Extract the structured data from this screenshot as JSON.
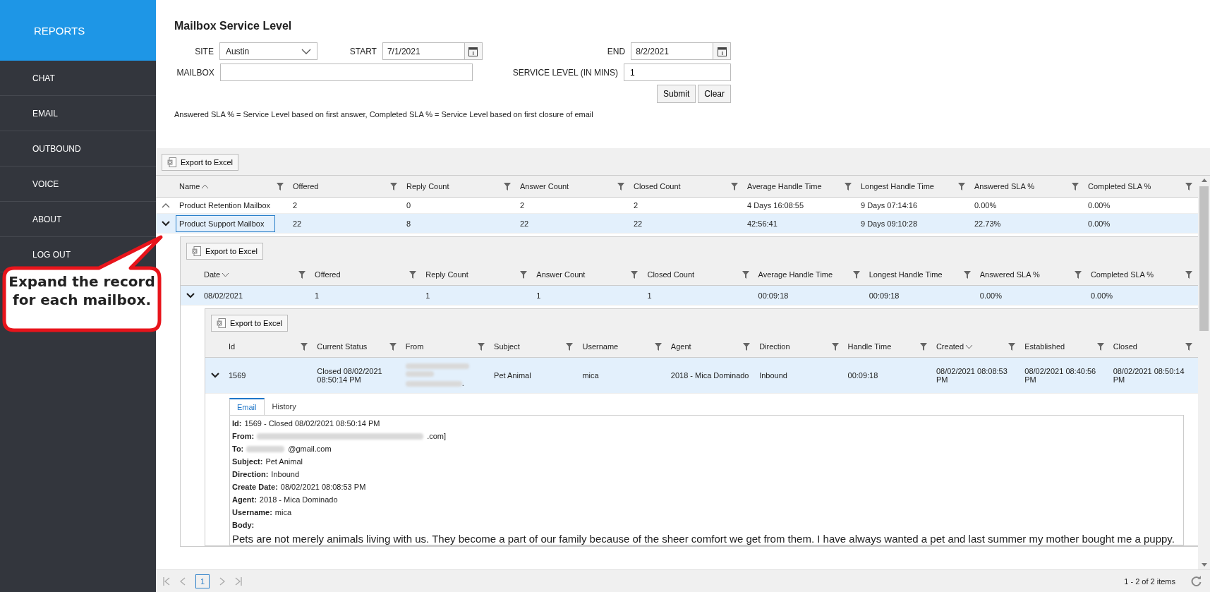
{
  "sidebar": {
    "header": "REPORTS",
    "items": [
      "CHAT",
      "EMAIL",
      "OUTBOUND",
      "VOICE",
      "ABOUT",
      "LOG OUT"
    ]
  },
  "form": {
    "title": "Mailbox Service Level",
    "site": {
      "label": "SITE",
      "value": "Austin"
    },
    "start": {
      "label": "START",
      "value": "7/1/2021"
    },
    "end": {
      "label": "END",
      "value": "8/2/2021"
    },
    "mailbox": {
      "label": "MAILBOX"
    },
    "service_level": {
      "label": "SERVICE LEVEL (IN MINS)",
      "value": "1"
    },
    "buttons": [
      "Submit",
      "Clear"
    ],
    "note": "Answered SLA % = Service Level based on first answer, Completed SLA % = Service Level based on first closure of email"
  },
  "grid": {
    "export": "Export to Excel",
    "columns": [
      {
        "label": "Name",
        "sorted": true
      },
      {
        "label": "Offered",
        "sorted": false
      },
      {
        "label": "Reply Count",
        "sorted": false
      },
      {
        "label": "Answer Count",
        "sorted": false
      },
      {
        "label": "Closed Count",
        "sorted": false
      },
      {
        "label": "Average Handle Time",
        "sorted": false
      },
      {
        "label": "Longest Handle Time",
        "sorted": false
      },
      {
        "label": "Answered SLA %",
        "sorted": false
      },
      {
        "label": "Completed SLA %",
        "sorted": false
      }
    ],
    "rows": [
      {
        "expanded": false,
        "selected": false,
        "cells": [
          "Product Retention Mailbox",
          "2",
          "0",
          "2",
          "2",
          "4 Days 16:08:55",
          "9 Days 07:14:16",
          "0.00%",
          "0.00%"
        ]
      },
      {
        "expanded": true,
        "selected": true,
        "cells": [
          "Product Support Mailbox",
          "22",
          "8",
          "22",
          "22",
          "42:56:41",
          "9 Days 09:10:28",
          "22.73%",
          "0.00%"
        ]
      }
    ],
    "detail": {
      "export": "Export to Excel",
      "columns": [
        {
          "label": "Date",
          "sorted": true
        },
        {
          "label": "Offered",
          "sorted": false
        },
        {
          "label": "Reply Count",
          "sorted": false
        },
        {
          "label": "Answer Count",
          "sorted": false
        },
        {
          "label": "Closed Count",
          "sorted": false
        },
        {
          "label": "Average Handle Time",
          "sorted": false
        },
        {
          "label": "Longest Handle Time",
          "sorted": false
        },
        {
          "label": "Answered SLA %",
          "sorted": false
        },
        {
          "label": "Completed SLA %",
          "sorted": false
        }
      ],
      "rows": [
        {
          "expanded": true,
          "cells": [
            "08/02/2021",
            "1",
            "1",
            "1",
            "1",
            "00:09:18",
            "00:09:18",
            "0.00%",
            "0.00%"
          ]
        }
      ],
      "detail": {
        "export": "Export to Excel",
        "columns": [
          {
            "label": "Id",
            "sorted": false
          },
          {
            "label": "Current Status",
            "sorted": false
          },
          {
            "label": "From",
            "sorted": false
          },
          {
            "label": "Subject",
            "sorted": false
          },
          {
            "label": "Username",
            "sorted": false
          },
          {
            "label": "Agent",
            "sorted": false
          },
          {
            "label": "Direction",
            "sorted": false
          },
          {
            "label": "Handle Time",
            "sorted": false
          },
          {
            "label": "Created",
            "sorted": true
          },
          {
            "label": "Established",
            "sorted": false
          },
          {
            "label": "Closed",
            "sorted": false
          }
        ],
        "rows": [
          {
            "expanded": true,
            "cells": [
              {
                "text": "1569",
                "redacted": false
              },
              {
                "text": "Closed 08/02/2021 08:50:14 PM",
                "redacted": false
              },
              {
                "text": ".",
                "redacted": true
              },
              {
                "text": "Pet Animal",
                "redacted": false
              },
              {
                "text": "mica",
                "redacted": false
              },
              {
                "text": "2018 - Mica Dominado",
                "redacted": false
              },
              {
                "text": "Inbound",
                "redacted": false
              },
              {
                "text": "00:09:18",
                "redacted": false
              },
              {
                "text": "08/02/2021 08:08:53 PM",
                "redacted": false
              },
              {
                "text": "08/02/2021 08:40:56 PM",
                "redacted": false
              },
              {
                "text": "08/02/2021 08:50:14 PM",
                "redacted": false
              }
            ]
          }
        ],
        "tabs": [
          {
            "label": "Email",
            "selected": true
          },
          {
            "label": "History",
            "selected": false
          }
        ],
        "fields": [
          {
            "label": "Id:",
            "value": "1569 - Closed 08/02/2021 08:50:14 PM",
            "redacted": false
          },
          {
            "label": "From:",
            "value": ".com]",
            "redacted": true
          },
          {
            "label": "To:",
            "value": "@gmail.com",
            "redacted": true
          },
          {
            "label": "Subject:",
            "value": "Pet Animal",
            "redacted": false
          },
          {
            "label": "Direction:",
            "value": "Inbound",
            "redacted": false
          },
          {
            "label": "Create Date:",
            "value": "08/02/2021 08:08:53 PM",
            "redacted": false
          },
          {
            "label": "Agent:",
            "value": "2018 - Mica Dominado",
            "redacted": false
          },
          {
            "label": "Username:",
            "value": "mica",
            "redacted": false
          },
          {
            "label": "Body:",
            "redacted": false
          }
        ],
        "body": "Pets are not merely animals living with us. They become a part of our family because of the sheer comfort we get from them. I have always wanted a pet and last summer my mother bought me a puppy."
      }
    }
  },
  "pager": {
    "page": "1",
    "info": "1 - 2 of 2 items"
  },
  "callout": "Expand the record for each mailbox."
}
